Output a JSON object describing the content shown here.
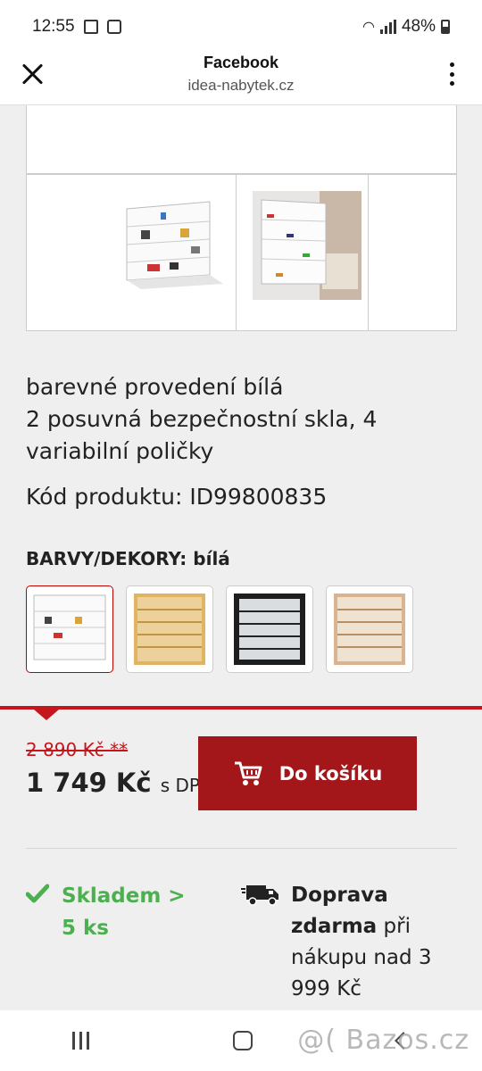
{
  "status_bar": {
    "time": "12:55",
    "battery": "48%"
  },
  "browser": {
    "title": "Facebook",
    "url": "idea-nabytek.cz"
  },
  "product": {
    "description": "barevné provedení bílá\n2 posuvná bezpečnostní skla, 4 variabilní poličky",
    "code": "Kód produktu: ID99800835",
    "color_label": "BARVY/DEKORY: bílá",
    "swatches": [
      {
        "name": "bílá",
        "color": "#ffffff"
      },
      {
        "name": "buk",
        "color": "#e0b462"
      },
      {
        "name": "černá",
        "color": "#1e1e1e"
      },
      {
        "name": "dub sonoma",
        "color": "#d9b48e"
      }
    ]
  },
  "price": {
    "old": "2 890 Kč **",
    "new": "1 749 Kč",
    "vat_note": "s DPH",
    "cart_label": "Do košíku"
  },
  "availability": {
    "stock": "Skladem > 5 ks",
    "shipping_bold": "Doprava zdarma",
    "shipping_rest": "při nákupu nad 3 999 Kč"
  },
  "watermark": "@( Bazos.cz",
  "colors": {
    "accent": "#c4161c",
    "cart_bg": "#a3171b",
    "stock_green": "#4caf50"
  },
  "icons": [
    "close-icon",
    "menu-dots-icon",
    "cart-icon",
    "check-icon",
    "truck-icon"
  ]
}
